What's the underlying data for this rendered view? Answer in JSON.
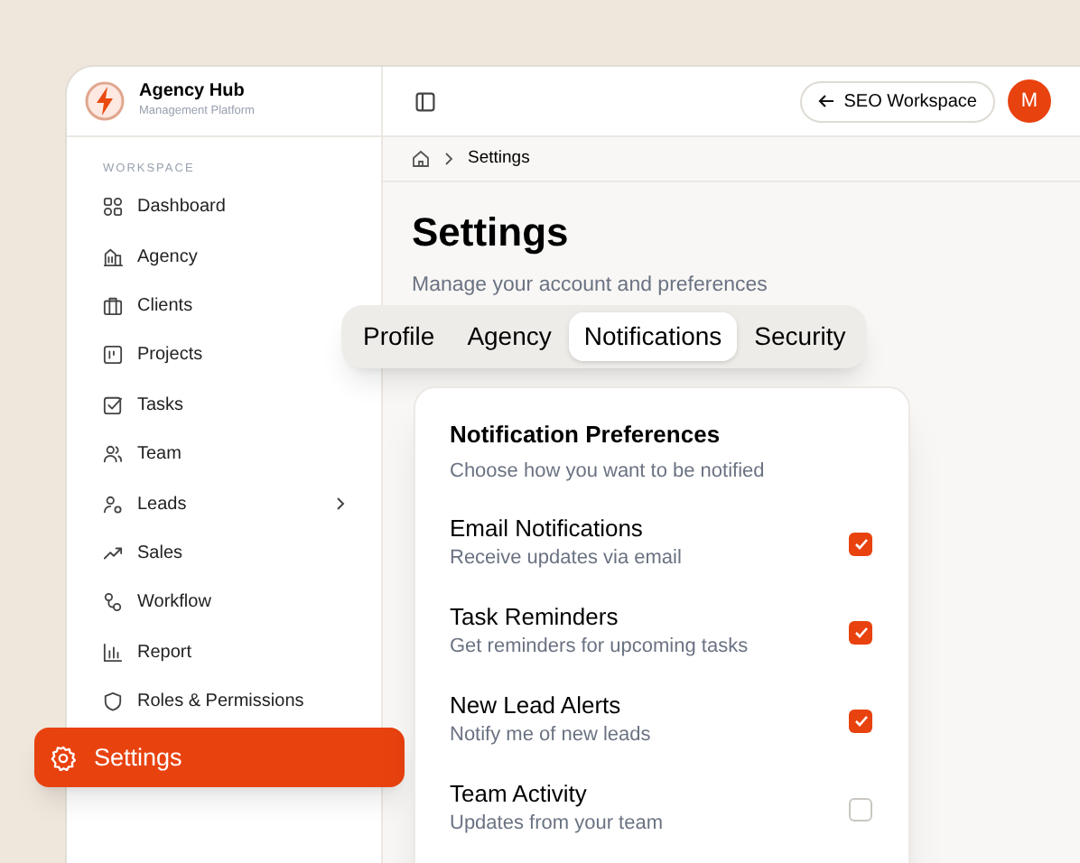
{
  "brand": {
    "name": "Agency Hub",
    "tagline": "Management Platform"
  },
  "sidebar": {
    "section": "WORKSPACE",
    "items": [
      {
        "label": "Dashboard",
        "kind": "item",
        "selected": false
      },
      {
        "label": "Agency",
        "kind": "item",
        "selected": false
      },
      {
        "label": "Clients",
        "kind": "item",
        "selected": false
      },
      {
        "label": "Projects",
        "kind": "item",
        "selected": false
      },
      {
        "label": "Tasks",
        "kind": "item",
        "selected": false
      },
      {
        "label": "Team",
        "kind": "item",
        "selected": false
      },
      {
        "label": "Leads",
        "kind": "group",
        "selected": false
      },
      {
        "label": "Sales",
        "kind": "item",
        "selected": false
      },
      {
        "label": "Workflow",
        "kind": "item",
        "selected": false
      },
      {
        "label": "Report",
        "kind": "item",
        "selected": false
      },
      {
        "label": "Roles & Permissions",
        "kind": "item",
        "selected": false
      },
      {
        "label": "Settings",
        "kind": "item",
        "selected": true
      }
    ]
  },
  "header": {
    "workspace_button": "SEO Workspace",
    "avatar": "M"
  },
  "breadcrumb": [
    "Settings"
  ],
  "page": {
    "title": "Settings",
    "subtitle": "Manage your account and preferences"
  },
  "tabs": [
    {
      "label": "Profile",
      "selected": false
    },
    {
      "label": "Agency",
      "selected": false
    },
    {
      "label": "Notifications",
      "selected": true
    },
    {
      "label": "Security",
      "selected": false
    }
  ],
  "card": {
    "title": "Notification Preferences",
    "subtitle": "Choose how you want to be notified",
    "options": [
      {
        "label": "Email Notifications",
        "description": "Receive updates via email",
        "checked": true
      },
      {
        "label": "Task Reminders",
        "description": "Get reminders for upcoming tasks",
        "checked": true
      },
      {
        "label": "New Lead Alerts",
        "description": "Notify me of new leads",
        "checked": true
      },
      {
        "label": "Team Activity",
        "description": "Updates from your team",
        "checked": false
      }
    ]
  }
}
